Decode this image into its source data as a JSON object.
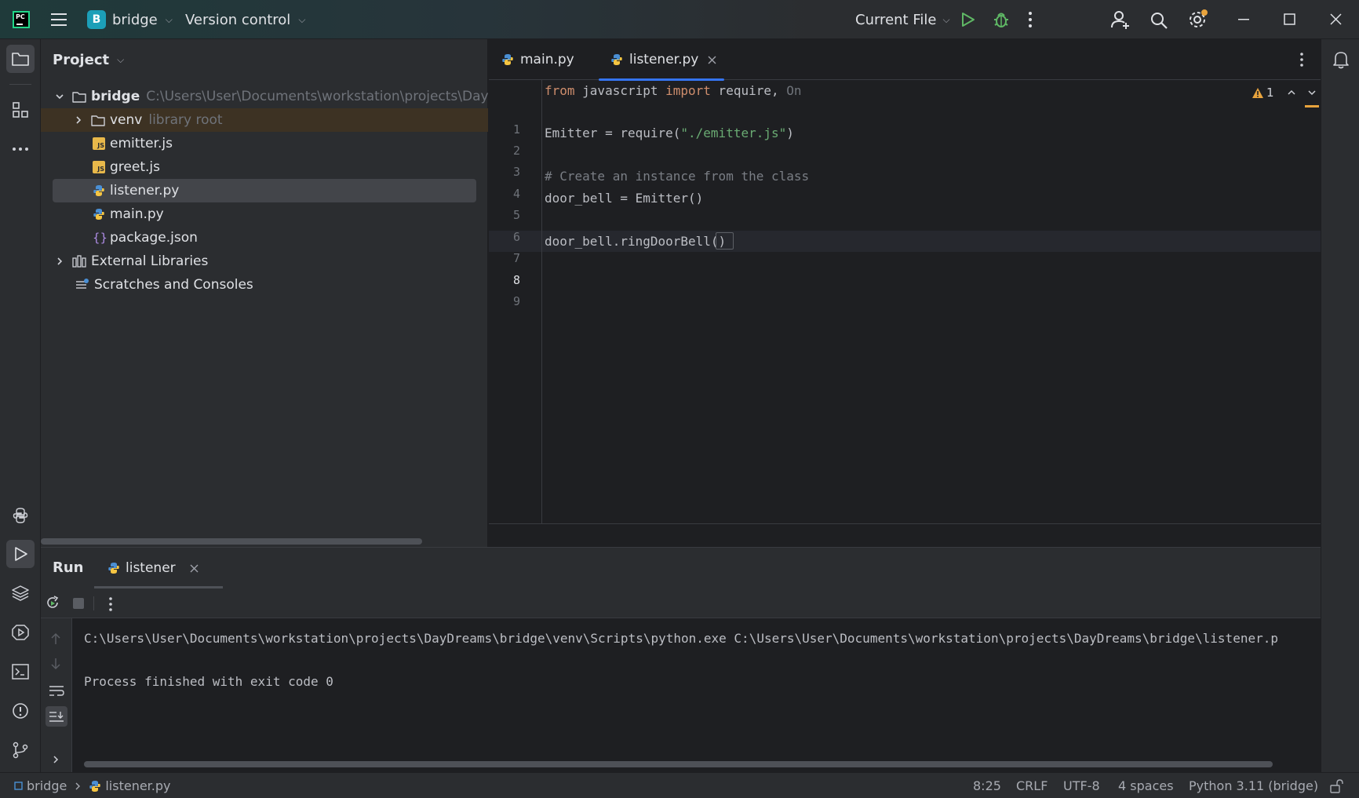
{
  "titlebar": {
    "app_logo": "PC",
    "project_badge": "B",
    "project_name": "bridge",
    "vcs_label": "Version control",
    "run_config": "Current File"
  },
  "project_panel": {
    "title": "Project",
    "root_name": "bridge",
    "root_path": "C:\\Users\\User\\Documents\\workstation\\projects\\DayDrea",
    "items": [
      {
        "label": "venv",
        "note": "library root"
      },
      {
        "label": "emitter.js"
      },
      {
        "label": "greet.js"
      },
      {
        "label": "listener.py"
      },
      {
        "label": "main.py"
      },
      {
        "label": "package.json"
      },
      {
        "label": "External Libraries"
      },
      {
        "label": "Scratches and Consoles"
      }
    ]
  },
  "editor": {
    "tabs": [
      {
        "label": "main.py"
      },
      {
        "label": "listener.py"
      }
    ],
    "inspections_count": "1",
    "line_numbers": [
      "1",
      "2",
      "3",
      "4",
      "5",
      "6",
      "7",
      "8",
      "9"
    ],
    "lines": {
      "l1_kw_from": "from",
      "l1_module": " javascript ",
      "l1_kw_import": "import",
      "l1_rest": " require, ",
      "l1_hint": "On",
      "l3_start": "Emitter = require(",
      "l3_str": "\"./emitter.js\"",
      "l3_end": ")",
      "l5_comment": "# Create an instance from the class",
      "l6": "door_bell = Emitter()",
      "l8": "door_bell.ringDoorBell()"
    }
  },
  "run_panel": {
    "title": "Run",
    "tab_label": "listener",
    "output": [
      "C:\\Users\\User\\Documents\\workstation\\projects\\DayDreams\\bridge\\venv\\Scripts\\python.exe C:\\Users\\User\\Documents\\workstation\\projects\\DayDreams\\bridge\\listener.p",
      "",
      "Process finished with exit code 0"
    ]
  },
  "statusbar": {
    "breadcrumb_project": "bridge",
    "breadcrumb_file": "listener.py",
    "position": "8:25",
    "line_ending": "CRLF",
    "encoding": "UTF-8",
    "indent": "4 spaces",
    "interpreter": "Python 3.11 (bridge)"
  },
  "colors": {
    "accent": "#3574f0",
    "run_green": "#5fb865",
    "warning": "#e8a33d"
  }
}
